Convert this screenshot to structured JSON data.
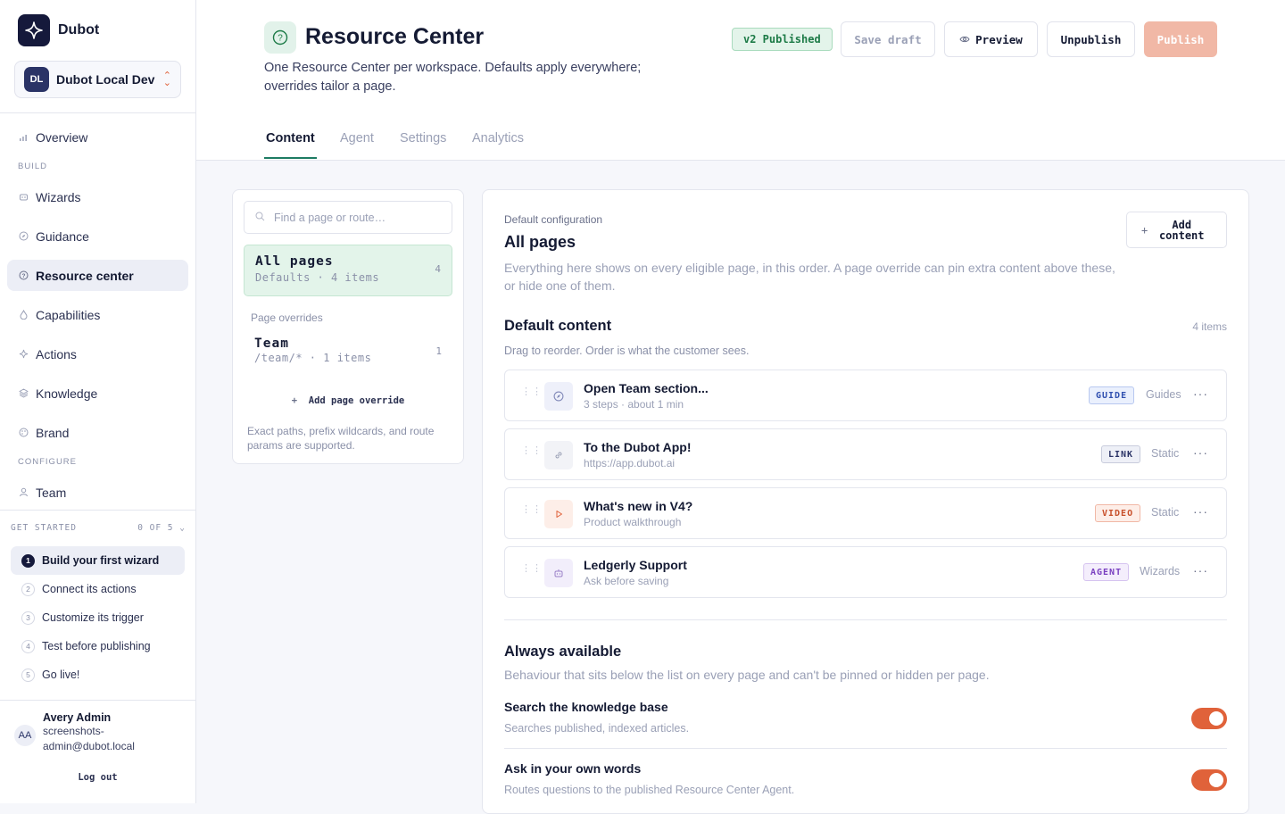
{
  "app": {
    "name": "Dubot"
  },
  "workspace": {
    "initials": "DL",
    "name": "Dubot Local Dev"
  },
  "nav": {
    "overview": "Overview",
    "build_label": "BUILD",
    "build": [
      {
        "label": "Wizards",
        "icon": "wizard-icon"
      },
      {
        "label": "Guidance",
        "icon": "compass-icon"
      },
      {
        "label": "Resource center",
        "icon": "help-icon",
        "active": true
      },
      {
        "label": "Capabilities",
        "icon": "drop-icon"
      },
      {
        "label": "Actions",
        "icon": "sparkle-icon"
      },
      {
        "label": "Knowledge",
        "icon": "layers-icon"
      },
      {
        "label": "Brand",
        "icon": "palette-icon"
      }
    ],
    "configure_label": "CONFIGURE",
    "configure": [
      {
        "label": "Team",
        "icon": "user-icon"
      }
    ]
  },
  "get_started": {
    "label": "GET STARTED",
    "progress": "0 OF 5",
    "steps": [
      {
        "num": "1",
        "label": "Build your first wizard"
      },
      {
        "num": "2",
        "label": "Connect its actions"
      },
      {
        "num": "3",
        "label": "Customize its trigger"
      },
      {
        "num": "4",
        "label": "Test before publishing"
      },
      {
        "num": "5",
        "label": "Go live!"
      }
    ]
  },
  "user": {
    "initials": "AA",
    "name": "Avery Admin",
    "email": "screenshots-admin@dubot.local",
    "logout": "Log out"
  },
  "header": {
    "title": "Resource Center",
    "desc": "One Resource Center per workspace. Defaults apply everywhere; overrides tailor a page.",
    "status": "v2 Published",
    "save_draft": "Save draft",
    "preview": "Preview",
    "unpublish": "Unpublish",
    "publish": "Publish"
  },
  "tabs": [
    "Content",
    "Agent",
    "Settings",
    "Analytics"
  ],
  "pages": {
    "search_placeholder": "Find a page or route…",
    "all": {
      "title": "All pages",
      "sub": "Defaults · 4 items",
      "count": "4"
    },
    "overrides_label": "Page overrides",
    "overrides": [
      {
        "title": "Team",
        "sub": "/team/* · 1 items",
        "count": "1"
      }
    ],
    "add_override": "Add page override",
    "note": "Exact paths, prefix wildcards, and route params are supported."
  },
  "config": {
    "label": "Default configuration",
    "title": "All pages",
    "desc": "Everything here shows on every eligible page, in this order. A page override can pin extra content above these, or hide one of them.",
    "add_content": "Add content",
    "default_title": "Default content",
    "default_count": "4 items",
    "default_desc": "Drag to reorder. Order is what the customer sees.",
    "items": [
      {
        "title": "Open Team section...",
        "sub": "3 steps · about 1 min",
        "badge": "GUIDE",
        "source": "Guides",
        "icon": "compass-icon"
      },
      {
        "title": "To the Dubot App!",
        "sub": "https://app.dubot.ai",
        "badge": "LINK",
        "source": "Static",
        "icon": "link-icon"
      },
      {
        "title": "What's new in V4?",
        "sub": "Product walkthrough",
        "badge": "VIDEO",
        "source": "Static",
        "icon": "play-icon"
      },
      {
        "title": "Ledgerly Support",
        "sub": "Ask before saving",
        "badge": "AGENT",
        "source": "Wizards",
        "icon": "bot-icon"
      }
    ],
    "always_title": "Always available",
    "always_desc": "Behaviour that sits below the list on every page and can't be pinned or hidden per page.",
    "toggles": [
      {
        "title": "Search the knowledge base",
        "sub": "Searches published, indexed articles.",
        "on": true
      },
      {
        "title": "Ask in your own words",
        "sub": "Routes questions to the published Resource Center Agent.",
        "on": true
      }
    ]
  },
  "colors": {
    "accent": "#e0623a",
    "brand": "#15193b",
    "success": "#1d7b47",
    "tab_underline": "#1d7b63"
  }
}
